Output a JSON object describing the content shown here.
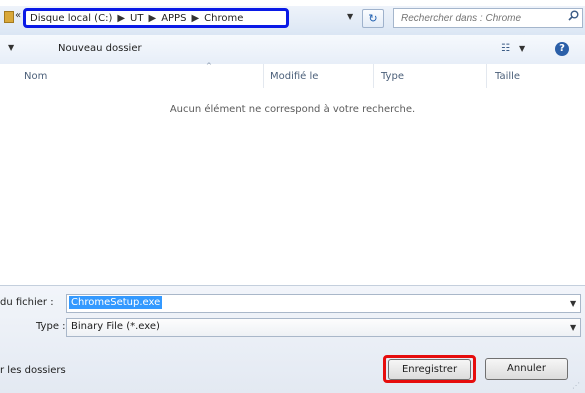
{
  "address": {
    "path": [
      "Disque local (C:)",
      "UT",
      "APPS",
      "Chrome"
    ],
    "separator": "▶",
    "back": "«",
    "dropdown": "▼",
    "refresh": "↻",
    "highlight_color": "#0a1ae6"
  },
  "search": {
    "placeholder": "Rechercher dans : Chrome",
    "icon": "search-icon"
  },
  "toolbar": {
    "organize_chevron": "▼",
    "new_folder": "Nouveau dossier",
    "view_icon": "☷",
    "view_chevron": "▼",
    "help": "?"
  },
  "columns": {
    "name": "Nom",
    "modified": "Modifié le",
    "type": "Type",
    "size": "Taille",
    "sort_arrow": "^"
  },
  "list": {
    "empty_message": "Aucun élément ne correspond à votre recherche."
  },
  "form": {
    "filename_label": "du fichier :",
    "filename_value": "ChromeSetup.exe",
    "type_label": "Type :",
    "type_value": "Binary File (*.exe)",
    "dropdown": "▼"
  },
  "footer": {
    "hide_folders": "r les dossiers",
    "save": "Enregistrer",
    "cancel": "Annuler",
    "save_highlight_color": "#e60d0d",
    "grip": "⋰"
  }
}
